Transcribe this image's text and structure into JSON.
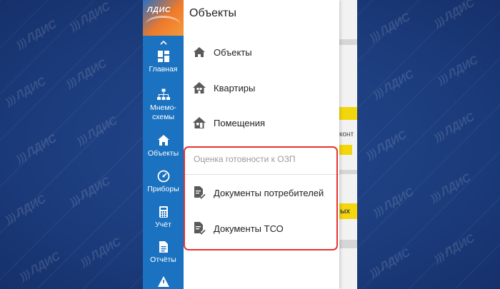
{
  "watermark": "ЛДИС",
  "logo": {
    "text": "ЛДИС"
  },
  "rail": {
    "items": [
      {
        "label": "Главная",
        "icon": "dashboard-icon"
      },
      {
        "label": "Мнемо-схемы",
        "label_line1": "Мнемо-",
        "label_line2": "схемы",
        "icon": "hierarchy-icon"
      },
      {
        "label": "Объекты",
        "icon": "home-icon"
      },
      {
        "label": "Приборы",
        "icon": "gauge-icon"
      },
      {
        "label": "Учёт",
        "icon": "calculator-icon"
      },
      {
        "label": "Отчёты",
        "icon": "document-icon"
      }
    ]
  },
  "panel": {
    "title": "Объекты",
    "items": [
      {
        "label": "Объекты",
        "icon": "home-icon"
      },
      {
        "label": "Квартиры",
        "icon": "apartment-icon"
      },
      {
        "label": "Помещения",
        "icon": "premises-icon"
      }
    ],
    "section": {
      "label": "Оценка готовности к ОЗП",
      "items": [
        {
          "label": "Документы потребителей",
          "icon": "document-check-icon"
        },
        {
          "label": "Документы ТСО",
          "icon": "document-check-icon"
        }
      ]
    }
  },
  "background_content": {
    "fragment_1": "конт",
    "fragment_2": "ых"
  },
  "colors": {
    "rail": "#1b72c0",
    "background": "#1d3f86",
    "highlight": "#e8322f",
    "accent_yellow": "#f4d60c"
  }
}
